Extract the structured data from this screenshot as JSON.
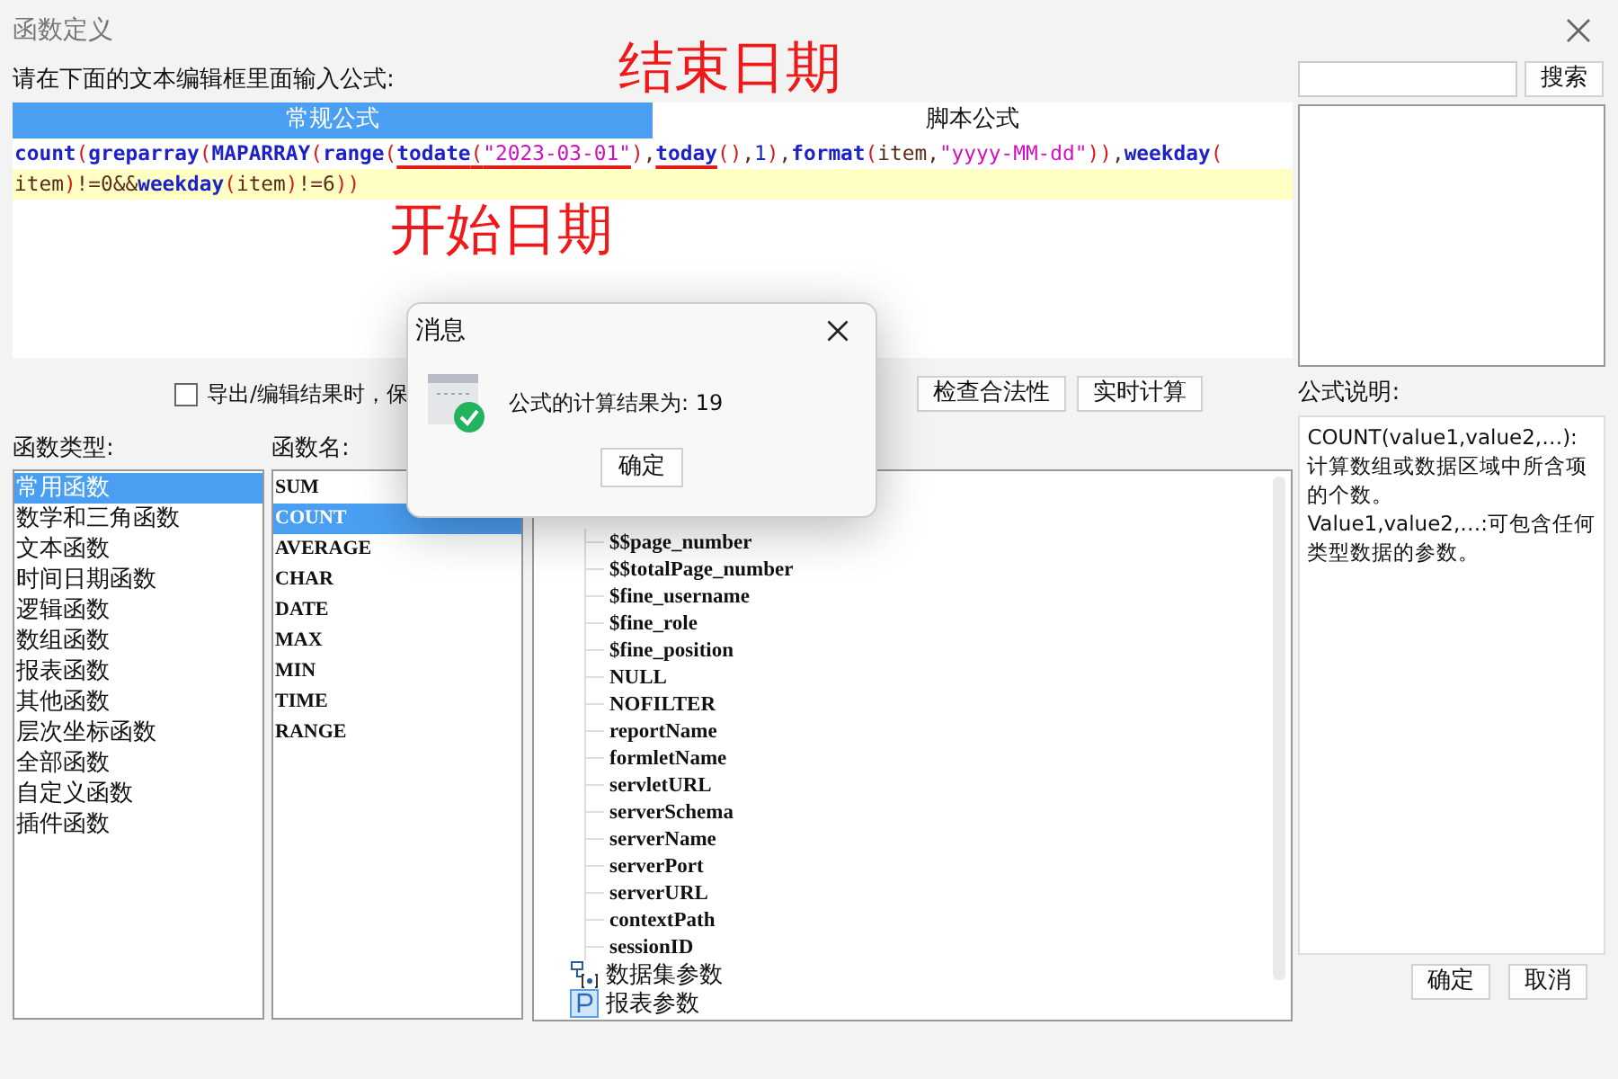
{
  "window": {
    "title": "函数定义"
  },
  "prompt": "请在下面的文本编辑框里面输入公式:",
  "tabs": [
    {
      "label": "常规公式",
      "selected": true
    },
    {
      "label": "脚本公式",
      "selected": false
    }
  ],
  "formula": {
    "lines": [
      {
        "highlighted": false,
        "tokens": [
          {
            "kind": "func",
            "text": "count",
            "underlined": false
          },
          {
            "kind": "paren",
            "text": "(",
            "underlined": false
          },
          {
            "kind": "func",
            "text": "greparray",
            "underlined": false
          },
          {
            "kind": "paren",
            "text": "(",
            "underlined": false
          },
          {
            "kind": "func",
            "text": "MAPARRAY",
            "underlined": false
          },
          {
            "kind": "paren",
            "text": "(",
            "underlined": false
          },
          {
            "kind": "func",
            "text": "range",
            "underlined": false
          },
          {
            "kind": "paren",
            "text": "(",
            "underlined": false
          },
          {
            "kind": "func",
            "text": "todate",
            "underlined": true
          },
          {
            "kind": "paren",
            "text": "(",
            "underlined": true
          },
          {
            "kind": "string",
            "text": "\"2023-03-01\"",
            "underlined": true
          },
          {
            "kind": "paren",
            "text": ")",
            "underlined": false
          },
          {
            "kind": "text",
            "text": ",",
            "underlined": false
          },
          {
            "kind": "func",
            "text": "today",
            "underlined": true
          },
          {
            "kind": "paren",
            "text": "()",
            "underlined": false
          },
          {
            "kind": "text",
            "text": ",",
            "underlined": false
          },
          {
            "kind": "number",
            "text": "1",
            "underlined": false
          },
          {
            "kind": "paren",
            "text": ")",
            "underlined": false
          },
          {
            "kind": "text",
            "text": ",",
            "underlined": false
          },
          {
            "kind": "func",
            "text": "format",
            "underlined": false
          },
          {
            "kind": "paren",
            "text": "(",
            "underlined": false
          },
          {
            "kind": "text",
            "text": "item,",
            "underlined": false
          },
          {
            "kind": "string",
            "text": "\"yyyy-MM-dd\"",
            "underlined": false
          },
          {
            "kind": "paren",
            "text": "))",
            "underlined": false
          },
          {
            "kind": "text",
            "text": ",",
            "underlined": false
          },
          {
            "kind": "func",
            "text": "weekday",
            "underlined": false
          },
          {
            "kind": "paren",
            "text": "(",
            "underlined": false
          }
        ]
      },
      {
        "highlighted": true,
        "tokens": [
          {
            "kind": "text",
            "text": "item",
            "underlined": false
          },
          {
            "kind": "paren",
            "text": ")",
            "underlined": false
          },
          {
            "kind": "text",
            "text": "!=0&&",
            "underlined": false
          },
          {
            "kind": "func",
            "text": "weekday",
            "underlined": false
          },
          {
            "kind": "paren",
            "text": "(",
            "underlined": false
          },
          {
            "kind": "text",
            "text": "item",
            "underlined": false
          },
          {
            "kind": "paren",
            "text": ")",
            "underlined": false
          },
          {
            "kind": "text",
            "text": "!=6",
            "underlined": false
          },
          {
            "kind": "paren",
            "text": "))",
            "underlined": false
          }
        ]
      }
    ]
  },
  "annotations": [
    {
      "text": "结束日期",
      "kind": "top"
    },
    {
      "text": "开始日期",
      "kind": "bottom"
    }
  ],
  "keep_option": {
    "label": "导出/编辑结果时，保",
    "checked": false
  },
  "buttons": [
    "检查合法性",
    "实时计算"
  ],
  "search": {
    "button": "搜索"
  },
  "categories": {
    "label": "函数类型:",
    "items": [
      {
        "label": "常用函数",
        "selected": true
      },
      {
        "label": "数学和三角函数",
        "selected": false
      },
      {
        "label": "文本函数",
        "selected": false
      },
      {
        "label": "时间日期函数",
        "selected": false
      },
      {
        "label": "逻辑函数",
        "selected": false
      },
      {
        "label": "数组函数",
        "selected": false
      },
      {
        "label": "报表函数",
        "selected": false
      },
      {
        "label": "其他函数",
        "selected": false
      },
      {
        "label": "层次坐标函数",
        "selected": false
      },
      {
        "label": "全部函数",
        "selected": false
      },
      {
        "label": "自定义函数",
        "selected": false
      },
      {
        "label": "插件函数",
        "selected": false
      }
    ]
  },
  "functions": {
    "label": "函数名:",
    "items": [
      {
        "label": "SUM",
        "selected": false
      },
      {
        "label": "COUNT",
        "selected": true
      },
      {
        "label": "AVERAGE",
        "selected": false
      },
      {
        "label": "CHAR",
        "selected": false
      },
      {
        "label": "DATE",
        "selected": false
      },
      {
        "label": "MAX",
        "selected": false
      },
      {
        "label": "MIN",
        "selected": false
      },
      {
        "label": "TIME",
        "selected": false
      },
      {
        "label": "RANGE",
        "selected": false
      }
    ]
  },
  "tree": {
    "variables": [
      "$$page_number",
      "$$totalPage_number",
      "$fine_username",
      "$fine_role",
      "$fine_position",
      "NULL",
      "NOFILTER",
      "reportName",
      "formletName",
      "servletURL",
      "serverSchema",
      "serverName",
      "serverPort",
      "serverURL",
      "contextPath",
      "sessionID"
    ],
    "nodes": [
      {
        "label": "数据集参数",
        "kind": "dataset"
      },
      {
        "label": "报表参数",
        "kind": "param"
      }
    ]
  },
  "description": {
    "label": "公式说明:",
    "paragraphs": [
      "COUNT(value1,value2,…):计算数组或数据区域中所含项的个数。",
      "Value1,value2,…:可包含任何类型数据的参数。"
    ]
  },
  "footer_buttons": [
    "确定",
    "取消"
  ],
  "dialog": {
    "title": "消息",
    "message": "公式的计算结果为: 19",
    "button": "确定"
  }
}
